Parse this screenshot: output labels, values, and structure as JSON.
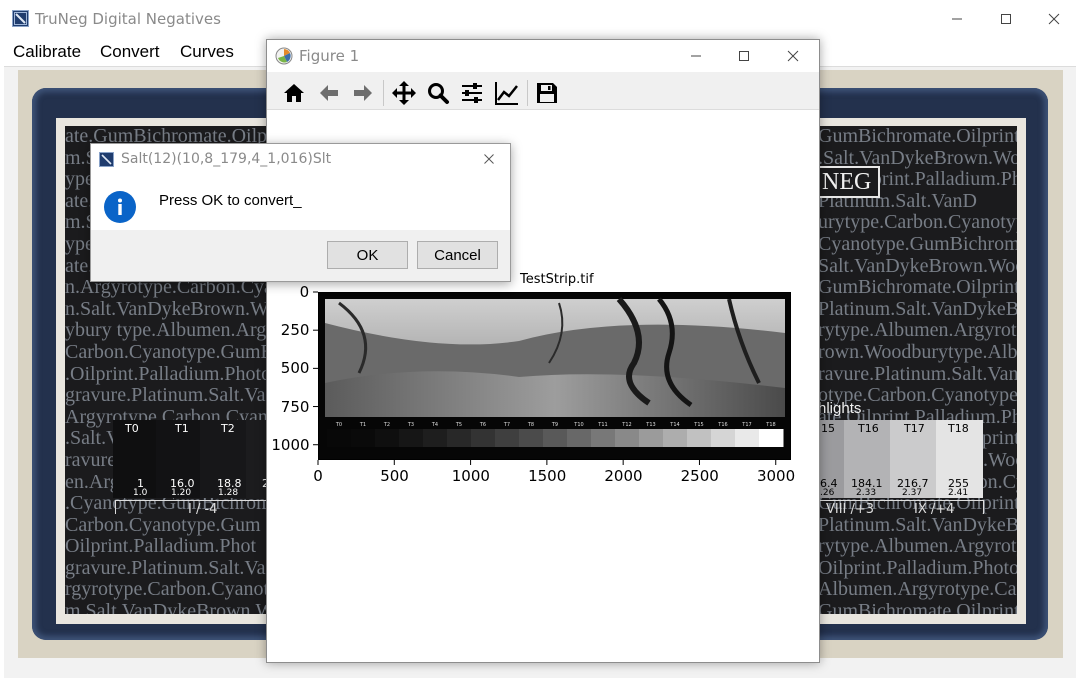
{
  "app": {
    "title": "TruNeg Digital Negatives",
    "menu": [
      "Calibrate",
      "Convert",
      "Curves"
    ]
  },
  "background": {
    "text_lines": [
      "ate.GumBichromate.Oilprint.Pa",
      "m.Salt.VanDykeBrown.Woodbury",
      "ype.Carbon.Cyanotype.Gum",
      "ate.Oilprint.Palladium.Photog",
      "m.Salt.VanDykeBrown.Woodbu",
      "ype.Albumen.Argyrotype.Carbo",
      "ate.Oilprint.Palladium.Photo",
      "n.Argyrotype.Carbon.Cyanoty",
      "n.Salt.VanDykeBrown.Woodbu",
      "ybury type.Albumen.Argyrotyp",
      "Carbon.Cyanotype.GumBichro",
      ".Oilprint.Palladium.Photogr",
      "gravure.Platinum.Salt.Van",
      "Argyrotype.Carbon.Cyanot",
      ".Salt.VanDykeBrown.Woodb",
      "ravure.Platinum.Salt.Van",
      "en.Argyrotype.Carbon.Cy",
      ".Cyanotype.GumBichromat",
      "Carbon.Cyanotype.Gum",
      "Oilprint.Palladium.Phot",
      "gravure.Platinum.Salt.Van",
      "rgyrotype.Carbon.Cyanotyp",
      "m.Salt.VanDykeBrown.Wo",
      "Argyrotype.Carbon.Cyanot",
      ".Cyanotype.GumBichromat"
    ],
    "right_text_lines": [
      "GumBichromate.Oilprint.",
      ".Salt.VanDykeBrown.Wood",
      "ate.Oilprint.Palladium.Ph",
      "Platinum.Salt.VanD",
      "urytype.Carbon.Cyanotype.Albu",
      "Cyanotype.GumBichromate.Oilp",
      "Salt.VanDykeBrown.Woodburyt",
      "GumBichromate.Oilprint.Palladiu",
      "Platinum.Salt.VanDykeBrown.Wood",
      "rytype.Albumen.Argyrotype.Car",
      "rown.Woodburytype.Albumen.Ar",
      "ravure.Platinum.Salt.VanDyk",
      "otype.Carbon.Cyanotype.Gu",
      "ate.Oilprint.Palladium.Pho",
      "GumBichromate.Oilprint.Pa",
      "Salt.VanDykeBrown.Wood",
      "en.Argyrotype.Carbon.Cy",
      "GumBichromate.Oilprint.Pa",
      "Platinum.Salt.VanDykeBrow",
      "rytype.Albumen.Argyrotype",
      "Oilprint.Palladium.Photogr",
      "Albumen.Argyrotype.Carb",
      "GumBichromate.Oilprint",
      "odburytype.Albumen.Ar"
    ],
    "logo_text": "NEG",
    "highlights_label": "hlights",
    "left_steps": [
      {
        "label": "T0",
        "value": "1",
        "density": "1.0"
      },
      {
        "label": "T1",
        "value": "16.0",
        "density": "1.20"
      },
      {
        "label": "T2",
        "value": "18.8",
        "density": "1.28"
      },
      {
        "label": "",
        "value": "2",
        "density": ""
      }
    ],
    "left_zone_label": "I / -4",
    "right_steps": [
      {
        "label": "15",
        "value": "6.4",
        "density": ".26"
      },
      {
        "label": "T16",
        "value": "184.1",
        "density": "2.33"
      },
      {
        "label": "T17",
        "value": "216.7",
        "density": "2.37"
      },
      {
        "label": "T18",
        "value": "255",
        "density": "2.41"
      }
    ],
    "right_zone_labels": [
      "VIII /+3",
      "IX /+4"
    ]
  },
  "figure": {
    "title": "Figure 1",
    "toolbar": [
      "home-icon",
      "back-icon",
      "forward-icon",
      "pan-icon",
      "zoom-icon",
      "configure-subplots-icon",
      "edit-axis-icon",
      "save-icon"
    ],
    "plot_title": "TestStrip.tif",
    "step_labels": [
      "T0",
      "T1",
      "T2",
      "T3",
      "T4",
      "T5",
      "T6",
      "T7",
      "T8",
      "T9",
      "T10",
      "T11",
      "T12",
      "T13",
      "T14",
      "T15",
      "T16",
      "T17",
      "T18"
    ],
    "colors": {
      "figure_bg": "#ffffff",
      "toolbar_bg": "#f0f0f0"
    }
  },
  "chart_data": {
    "type": "image",
    "title": "TestStrip.tif",
    "x_ticks": [
      "0",
      "500",
      "1000",
      "1500",
      "2000",
      "2500",
      "3000"
    ],
    "y_ticks": [
      "0",
      "250",
      "500",
      "750",
      "1000"
    ],
    "xlim": [
      0,
      3100
    ],
    "ylim": [
      1100,
      0
    ]
  },
  "dialog": {
    "title": "Salt(12)(10,8_179,4_1,016)Slt",
    "message": "Press OK to convert_",
    "ok_label": "OK",
    "cancel_label": "Cancel",
    "icon": "info-icon",
    "accent": "#0a64c8"
  }
}
